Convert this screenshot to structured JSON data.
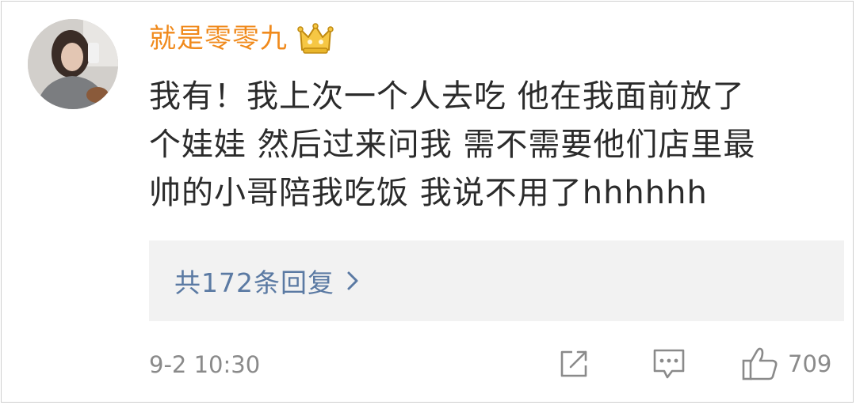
{
  "comment": {
    "username": "就是零零九",
    "badge_icon": "crown-badge-icon",
    "text_lines": [
      "我有！我上次一个人去吃 他在我面前放了",
      "个娃娃 然后过来问我 需不需要他们店里最",
      "帅的小哥陪我吃饭 我说不用了hhhhhh"
    ],
    "replies_label": "共172条回复",
    "timestamp": "9-2 10:30",
    "likes": "709"
  },
  "colors": {
    "username": "#f08a1c",
    "text": "#2b2b2b",
    "link": "#5b7aa3",
    "meta": "#8a8a8a",
    "replies_bg": "#f2f2f2"
  }
}
